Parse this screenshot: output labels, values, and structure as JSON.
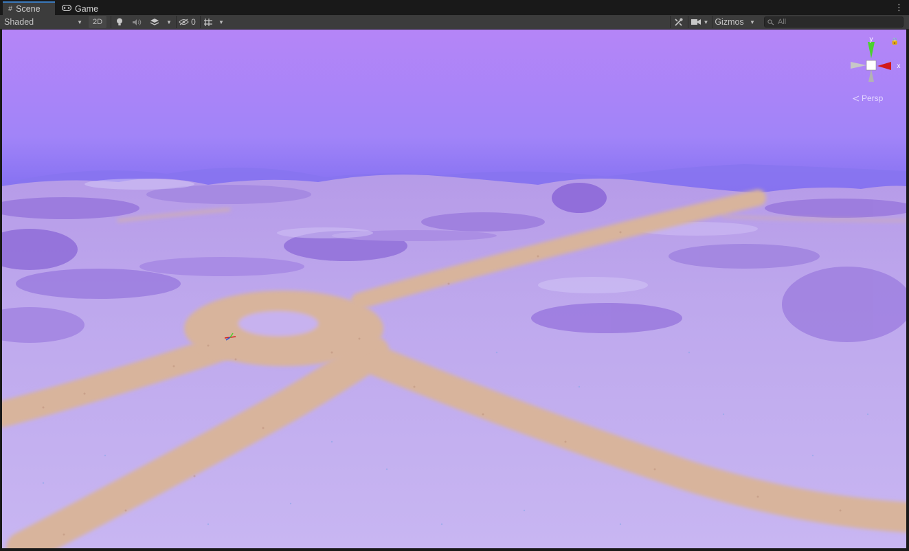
{
  "tabs": [
    {
      "label": "Scene",
      "icon": "hash-icon",
      "active": true
    },
    {
      "label": "Game",
      "icon": "gamepad-icon",
      "active": false
    }
  ],
  "toolbar": {
    "draw_mode": "Shaded",
    "toggle_2d": "2D",
    "hidden_count": "0",
    "gizmos_label": "Gizmos",
    "search_placeholder": "All"
  },
  "viewport": {
    "projection_label": "Persp",
    "axes": {
      "y": "y",
      "x": "x"
    }
  },
  "colors": {
    "sky_top": "#b585f7",
    "sky_horizon": "#7b6af0",
    "terrain": "#c3b0ee",
    "path": "#d9b39a",
    "axis_y": "#4bd12e",
    "axis_x": "#d21a1a"
  }
}
